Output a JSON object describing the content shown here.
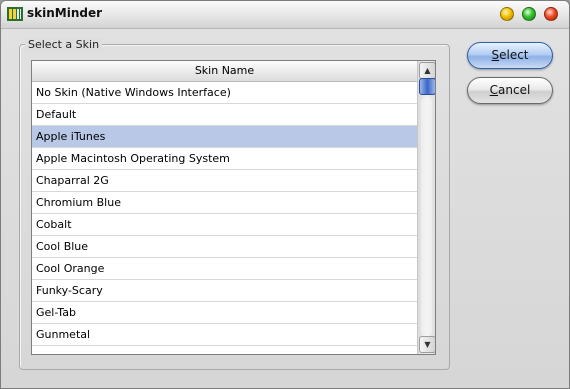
{
  "window": {
    "title": "skinMinder"
  },
  "group": {
    "label": "Select a Skin"
  },
  "list": {
    "column_header": "Skin Name",
    "selected_index": 2,
    "rows": [
      "No Skin (Native Windows Interface)",
      "Default",
      "Apple iTunes",
      "Apple Macintosh Operating System",
      "Chaparral 2G",
      "Chromium Blue",
      "Cobalt",
      "Cool Blue",
      "Cool Orange",
      "Funky-Scary",
      "Gel-Tab",
      "Gunmetal",
      ""
    ]
  },
  "buttons": {
    "select_label": "Select",
    "cancel_label": "Cancel"
  },
  "icons": {
    "app": "skinminder-app-icon",
    "minimize": "minimize-orb-icon",
    "maximize": "maximize-orb-icon",
    "close": "close-orb-icon",
    "scroll_up": "arrow-up-icon",
    "scroll_down": "arrow-down-icon"
  },
  "colors": {
    "selection": "#b8c8e6",
    "primary_button": "#8fb1e6",
    "minimize": "#f2c100",
    "maximize": "#35c02e",
    "close": "#f04a22"
  }
}
